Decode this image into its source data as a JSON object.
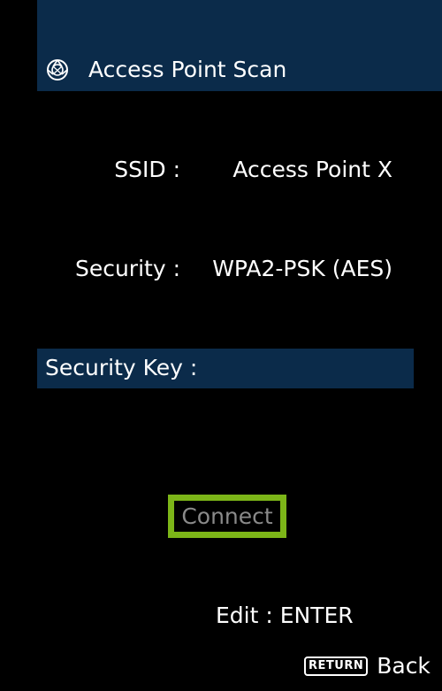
{
  "header": {
    "icon": "network-globe-icon",
    "title": "Access Point Scan"
  },
  "details": {
    "ssid_label": "SSID :",
    "ssid_value": "Access Point X",
    "security_label": "Security :",
    "security_value": "WPA2-PSK (AES)"
  },
  "security_key": {
    "label": "Security Key :",
    "value": ""
  },
  "connect": {
    "label": "Connect"
  },
  "footer": {
    "edit_hint": "Edit : ENTER",
    "return_key_label": "RETURN",
    "back_label": "Back"
  },
  "colors": {
    "background": "#000000",
    "bar": "#0b2b4a",
    "focus_border": "#7cb518",
    "disabled_text": "#8a8a8a",
    "text": "#ffffff"
  }
}
